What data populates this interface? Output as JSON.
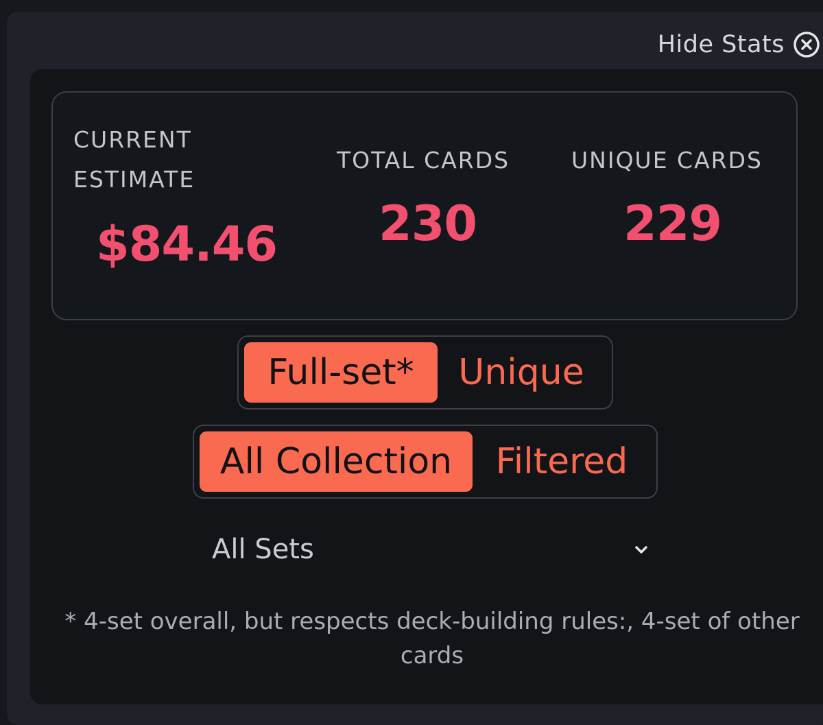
{
  "header": {
    "hide_stats_label": "Hide Stats",
    "close_icon": "circle-x-icon"
  },
  "stats": {
    "current_estimate_label_line1": "CURRENT",
    "current_estimate_label_line2": "ESTIMATE",
    "current_estimate_value": "$84.46",
    "total_cards_label": "TOTAL CARDS",
    "total_cards_value": "230",
    "unique_cards_label": "UNIQUE CARDS",
    "unique_cards_value": "229"
  },
  "mode_toggle": {
    "options": [
      {
        "label": "Full-set*",
        "active": true
      },
      {
        "label": "Unique",
        "active": false
      }
    ]
  },
  "scope_toggle": {
    "options": [
      {
        "label": "All Collection",
        "active": true
      },
      {
        "label": "Filtered",
        "active": false
      }
    ]
  },
  "set_select": {
    "value": "All Sets",
    "icon": "chevron-down-icon"
  },
  "footnote": "* 4-set overall, but respects deck-building rules:, 4-set of other cards",
  "colors": {
    "accent": "#fa6a50",
    "value_text": "#f2506e",
    "background": "#121418"
  }
}
